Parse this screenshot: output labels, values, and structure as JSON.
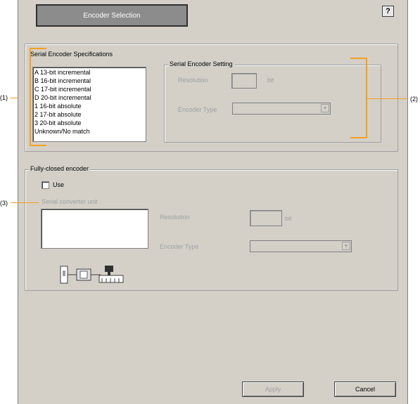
{
  "dialog": {
    "title": "Encoder Selection",
    "help_label": "?"
  },
  "spec_group": {
    "legend": "Serial Encoder Specifications",
    "items": [
      "A 13-bit incremental",
      "B 16-bit incremental",
      "C 17-bit incremental",
      "D 20-bit incremental",
      "1 16-bit absolute",
      "2 17-bit absolute",
      "3 20-bit absolute",
      "Unknown/No match"
    ]
  },
  "setting_group": {
    "legend": "Serial Encoder Setting",
    "resolution_label": "Resolution",
    "resolution_value": "",
    "resolution_unit": "bit",
    "encoder_type_label": "Encoder Type",
    "encoder_type_value": ""
  },
  "fully_closed": {
    "legend": "Fully-closed encoder",
    "use_label": "Use",
    "use_checked": false,
    "converter_label": "Serial converter unit",
    "resolution_label": "Resolution",
    "resolution_value": "",
    "resolution_unit": "bit",
    "encoder_type_label": "Encoder Type",
    "encoder_type_value": ""
  },
  "callouts": {
    "c1": "(1)",
    "c2": "(2)",
    "c3": "(3)"
  },
  "buttons": {
    "apply": "Apply",
    "cancel": "Cancel"
  },
  "colors": {
    "panel": "#d4d0c8",
    "title_button": "#8c8c8c",
    "callout_orange": "#f4a020"
  }
}
